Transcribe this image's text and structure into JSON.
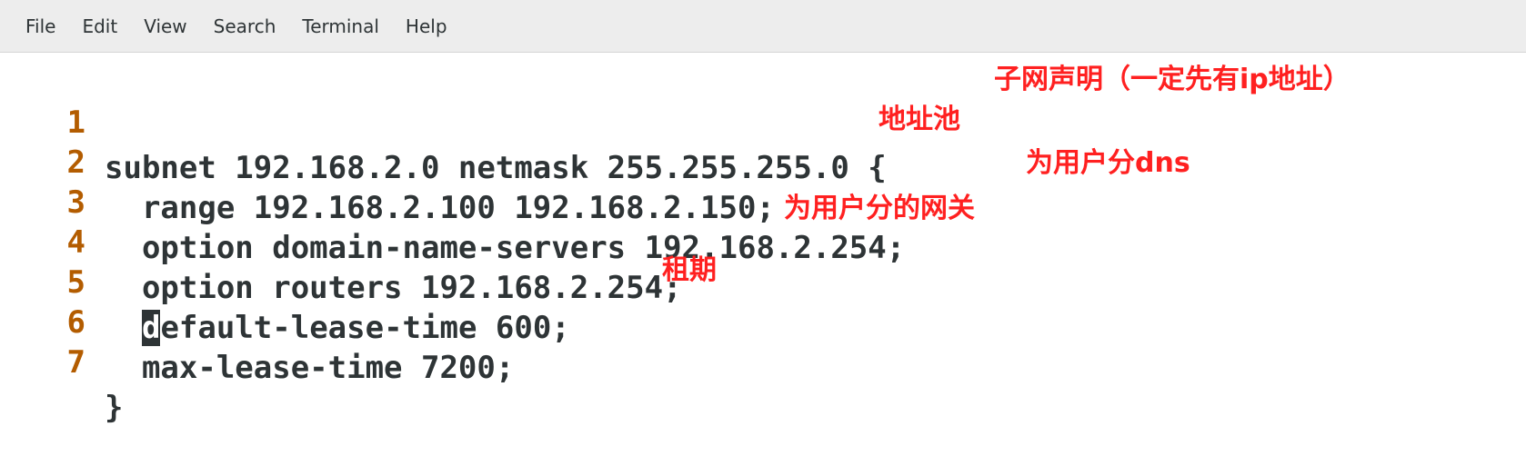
{
  "menu": [
    "File",
    "Edit",
    "View",
    "Search",
    "Terminal",
    "Help"
  ],
  "lines": [
    {
      "number": "1",
      "code": "subnet 192.168.2.0 netmask 255.255.255.0 {"
    },
    {
      "number": "2",
      "code": "  range 192.168.2.100 192.168.2.150;"
    },
    {
      "number": "3",
      "code": "  option domain-name-servers 192.168.2.254;"
    },
    {
      "number": "4",
      "code": "  option routers 192.168.2.254;"
    },
    {
      "number": "5",
      "code_before": "  ",
      "cursor_char": "d",
      "code_after": "efault-lease-time 600;"
    },
    {
      "number": "6",
      "code": "  max-lease-time 7200;"
    },
    {
      "number": "7",
      "code": "}"
    }
  ],
  "annotations": [
    {
      "text": "子网声明（一定先有ip地址）",
      "color": "#ff2020"
    },
    {
      "text": "地址池",
      "color": "#ff2020"
    },
    {
      "text": "为用户分dns",
      "color": "#ff2020"
    },
    {
      "text": "为用户分的网关",
      "color": "#ff2020"
    },
    {
      "text": "租期",
      "color": "#ff2020"
    }
  ]
}
